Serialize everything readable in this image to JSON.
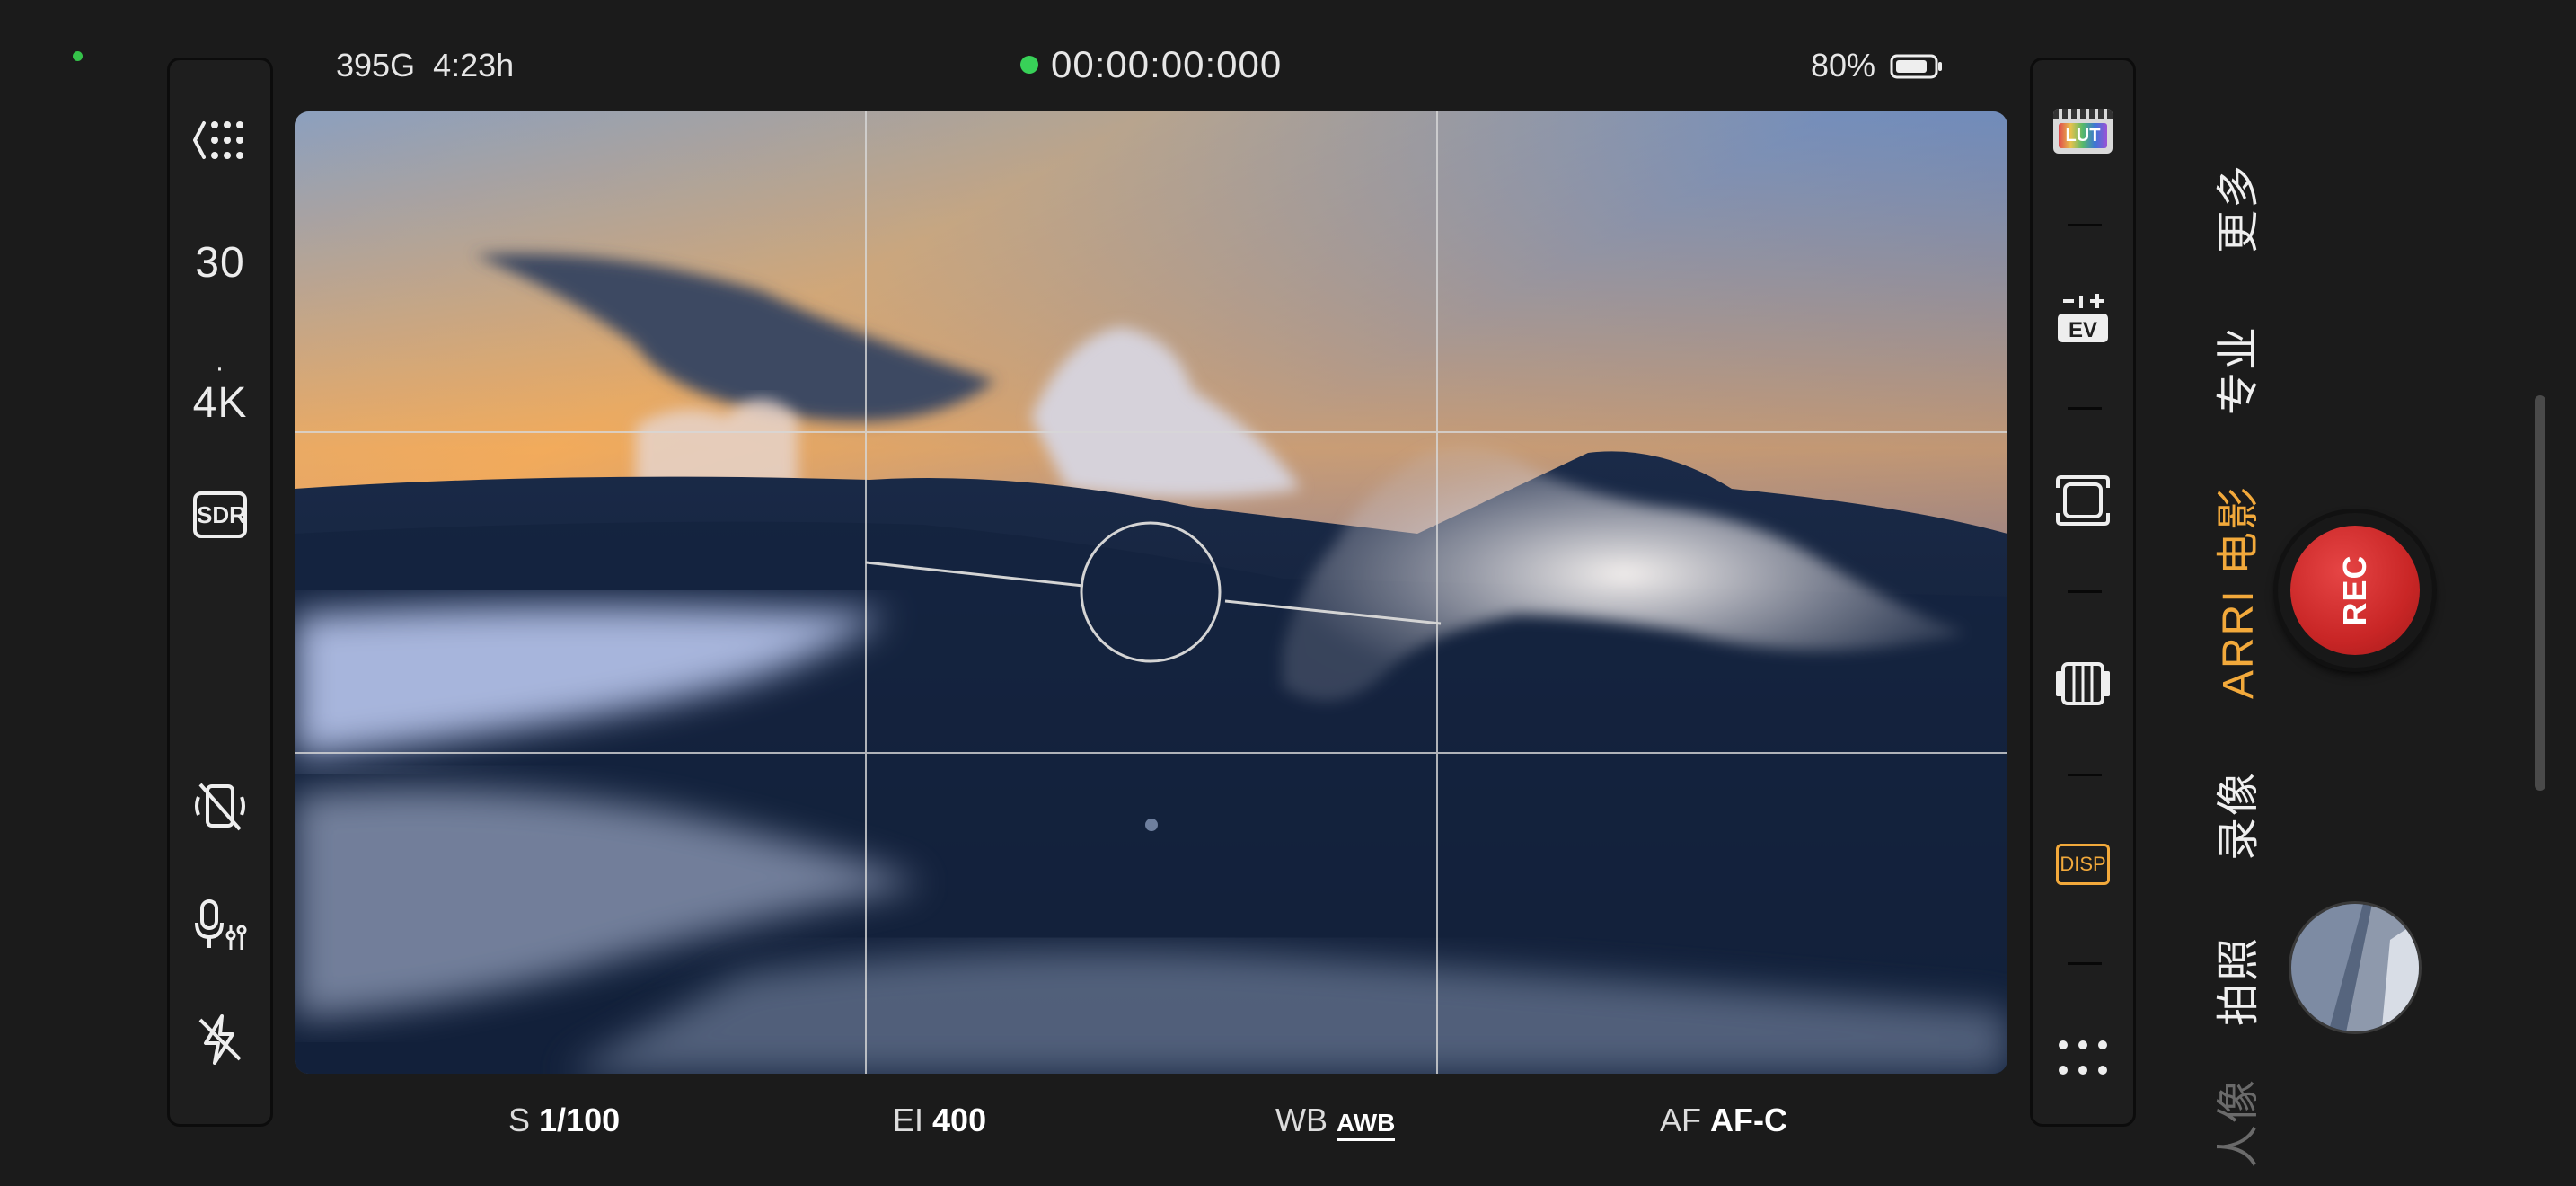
{
  "top": {
    "storage": "395G",
    "duration": "4:23h",
    "timecode": "00:00:00:000",
    "battery": "80%"
  },
  "left_bar": {
    "frame_rate": "30",
    "separator": "·",
    "resolution": "4K",
    "dynamic_range": "SDR",
    "icons": [
      "back-grid-icon",
      "no-stabilization-icon",
      "mic-settings-icon",
      "flash-off-icon"
    ]
  },
  "bottom": {
    "shutter_label": "S",
    "shutter_value": "1/100",
    "ei_label": "EI",
    "ei_value": "400",
    "wb_label": "WB",
    "wb_value": "AWB",
    "af_label": "AF",
    "af_value": "AF-C"
  },
  "right_bar": {
    "lut_label": "LUT",
    "ev_label": "EV",
    "disp_label": "DISP",
    "icons": [
      "lut-icon",
      "ev-icon",
      "frame-icon",
      "film-icon",
      "disp-icon",
      "more-dots-icon"
    ]
  },
  "modes": [
    {
      "label": "更多",
      "active": false
    },
    {
      "label": "专业",
      "active": false
    },
    {
      "label": "ARRI 电影",
      "active": true
    },
    {
      "label": "录像",
      "active": false
    },
    {
      "label": "拍照",
      "active": false
    },
    {
      "label": "人像",
      "active": false
    }
  ],
  "record_button": {
    "label": "REC"
  },
  "colors": {
    "accent": "#f2a93b",
    "record": "#d42f2f",
    "status_green": "#38d158"
  }
}
